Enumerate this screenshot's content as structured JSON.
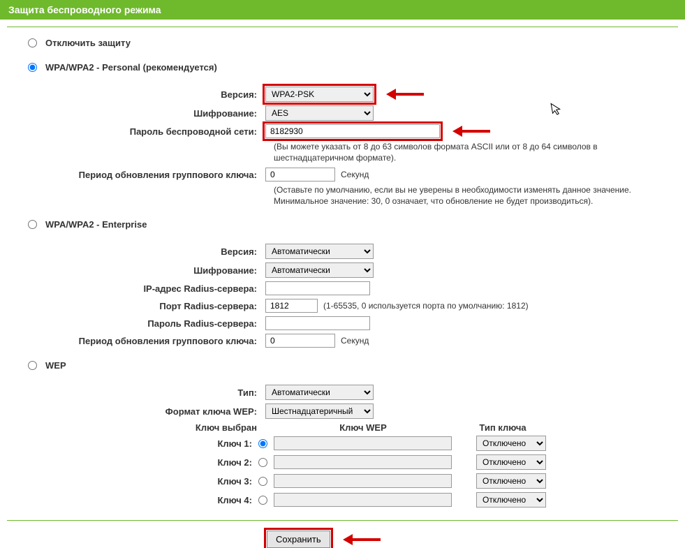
{
  "header": {
    "title": "Защита беспроводного режима"
  },
  "options": {
    "disable": {
      "label": "Отключить защиту"
    },
    "personal": {
      "label": "WPA/WPA2 - Personal (рекомендуется)"
    },
    "enterprise": {
      "label": "WPA/WPA2 - Enterprise"
    },
    "wep": {
      "label": "WEP"
    }
  },
  "personal": {
    "version_label": "Версия:",
    "version_value": "WPA2-PSK",
    "cipher_label": "Шифрование:",
    "cipher_value": "AES",
    "password_label": "Пароль беспроводной сети:",
    "password_value": "8182930",
    "password_hint": "(Вы можете указать от 8 до 63 символов формата ASCII или от 8 до 64 символов в шестнадцатеричном формате).",
    "rekey_label": "Период обновления группового ключа:",
    "rekey_value": "0",
    "rekey_unit": "Секунд",
    "rekey_hint": "(Оставьте по умолчанию, если вы не уверены в необходимости изменять данное значение. Минимальное значение: 30, 0 означает, что обновление не будет производиться)."
  },
  "enterprise": {
    "version_label": "Версия:",
    "version_value": "Автоматически",
    "cipher_label": "Шифрование:",
    "cipher_value": "Автоматически",
    "radius_ip_label": "IP-адрес Radius-сервера:",
    "radius_ip_value": "",
    "radius_port_label": "Порт Radius-сервера:",
    "radius_port_value": "1812",
    "radius_port_hint": "(1-65535, 0 используется порта по умолчанию: 1812)",
    "radius_pw_label": "Пароль Radius-сервера:",
    "radius_pw_value": "",
    "rekey_label": "Период обновления группового ключа:",
    "rekey_value": "0",
    "rekey_unit": "Секунд"
  },
  "wep": {
    "type_label": "Тип:",
    "type_value": "Автоматически",
    "format_label": "Формат ключа WEP:",
    "format_value": "Шестнадцатеричный",
    "col_selected": "Ключ выбран",
    "col_key": "Ключ WEP",
    "col_type": "Тип ключа",
    "keys": [
      {
        "label": "Ключ 1:",
        "value": "",
        "type": "Отключено",
        "selected": true
      },
      {
        "label": "Ключ 2:",
        "value": "",
        "type": "Отключено",
        "selected": false
      },
      {
        "label": "Ключ 3:",
        "value": "",
        "type": "Отключено",
        "selected": false
      },
      {
        "label": "Ключ 4:",
        "value": "",
        "type": "Отключено",
        "selected": false
      }
    ]
  },
  "footer": {
    "save": "Сохранить"
  }
}
